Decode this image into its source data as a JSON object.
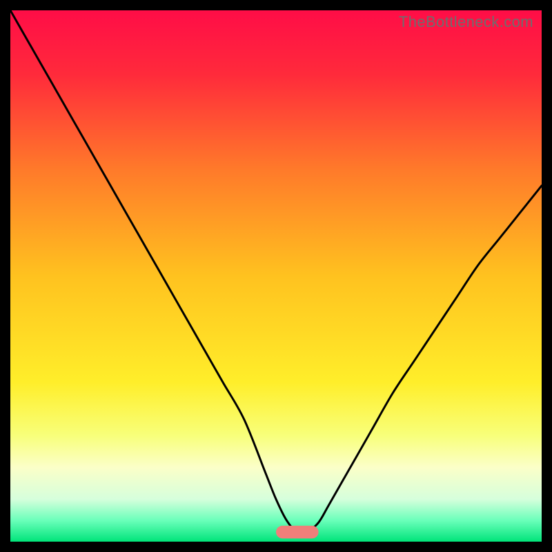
{
  "watermark": "TheBottleneck.com",
  "chart_data": {
    "type": "line",
    "title": "",
    "xlabel": "",
    "ylabel": "",
    "xlim": [
      0,
      100
    ],
    "ylim": [
      0,
      100
    ],
    "gradient_stops": [
      {
        "pct": 0,
        "color": "#ff0d47"
      },
      {
        "pct": 12,
        "color": "#ff2a3b"
      },
      {
        "pct": 30,
        "color": "#ff7a2a"
      },
      {
        "pct": 50,
        "color": "#ffc21f"
      },
      {
        "pct": 70,
        "color": "#ffee2a"
      },
      {
        "pct": 80,
        "color": "#f8ff7a"
      },
      {
        "pct": 86,
        "color": "#fbffc8"
      },
      {
        "pct": 92,
        "color": "#d6ffdc"
      },
      {
        "pct": 96,
        "color": "#6affba"
      },
      {
        "pct": 100,
        "color": "#00e47a"
      }
    ],
    "marker": {
      "x": 54,
      "y": 1.8,
      "width": 8,
      "height": 2.4,
      "color": "#ef7f7a",
      "radius": 1.2
    },
    "series": [
      {
        "name": "bottleneck-curve",
        "color": "#000000",
        "x": [
          0,
          4,
          8,
          12,
          16,
          20,
          24,
          28,
          32,
          36,
          40,
          44,
          48,
          50,
          52,
          54,
          56,
          58,
          60,
          64,
          68,
          72,
          76,
          80,
          84,
          88,
          92,
          96,
          100
        ],
        "y": [
          100,
          93,
          86,
          79,
          72,
          65,
          58,
          51,
          44,
          37,
          30,
          23,
          13,
          8,
          4,
          1.8,
          2.0,
          3.6,
          7,
          14,
          21,
          28,
          34,
          40,
          46,
          52,
          57,
          62,
          67
        ]
      }
    ]
  }
}
